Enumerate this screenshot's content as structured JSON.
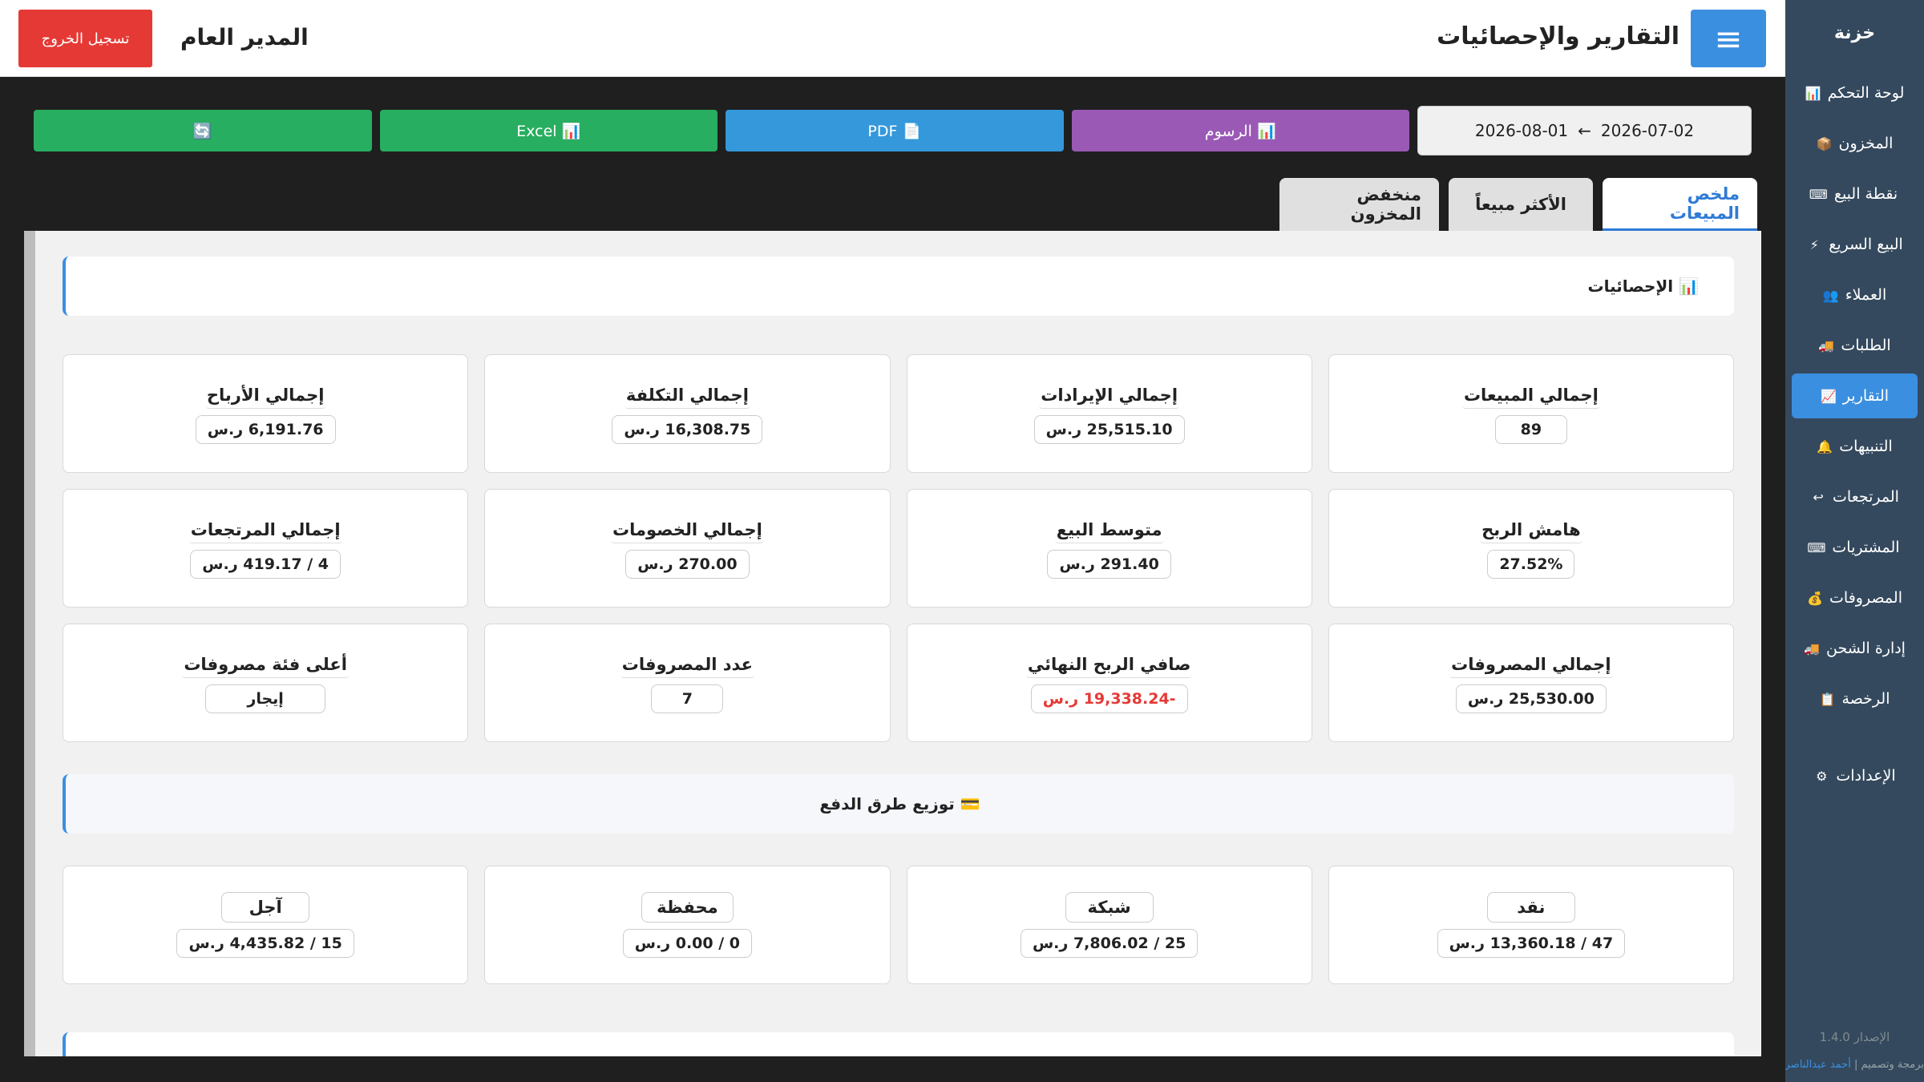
{
  "sidebar": {
    "brand": "خزنة",
    "items": [
      {
        "label": "لوحة التحكم",
        "icon": "📊"
      },
      {
        "label": "المخزون",
        "icon": "📦"
      },
      {
        "label": "نقطة البيع",
        "icon": "⌨"
      },
      {
        "label": "البيع السريع",
        "icon": "⚡"
      },
      {
        "label": "العملاء",
        "icon": "👥"
      },
      {
        "label": "الطلبات",
        "icon": "🚚"
      },
      {
        "label": "التقارير",
        "icon": "📈"
      },
      {
        "label": "التنبيهات",
        "icon": "🔔"
      },
      {
        "label": "المرتجعات",
        "icon": "↩"
      },
      {
        "label": "المشتريات",
        "icon": "⌨"
      },
      {
        "label": "المصروفات",
        "icon": "💰"
      },
      {
        "label": "إدارة الشحن",
        "icon": "🚚"
      },
      {
        "label": "الرخصة",
        "icon": "📋"
      },
      {
        "label": "الإعدادات",
        "icon": "⚙"
      }
    ],
    "active_index": 6,
    "version": "الإصدار 1.4.0",
    "credit_prefix": "برمجة وتصميم |",
    "credit_name": "أحمد عبدالناصر"
  },
  "header": {
    "title": "التقارير والإحصائيات",
    "menu_icon": "≡",
    "user": "المدير العام",
    "logout": "تسجيل الخروج"
  },
  "toolbar": {
    "date_from": "2026-07-02",
    "date_arrow": "←",
    "date_to": "2026-08-01",
    "charts": "📊 الرسوم",
    "pdf": "📄 PDF",
    "excel": "📊 Excel",
    "refresh": "🔄"
  },
  "tabs": [
    "ملخص المبيعات",
    "الأكثر مبيعاً",
    "منخفض المخزون"
  ],
  "stats": {
    "title": "📊 الإحصائيات",
    "cards": [
      {
        "label": "إجمالي المبيعات",
        "value": "89"
      },
      {
        "label": "إجمالي الإيرادات",
        "value": "25,515.10 ر.س"
      },
      {
        "label": "إجمالي التكلفة",
        "value": "16,308.75 ر.س"
      },
      {
        "label": "إجمالي الأرباح",
        "value": "6,191.76 ر.س"
      },
      {
        "label": "هامش الربح",
        "value": "27.52%"
      },
      {
        "label": "متوسط البيع",
        "value": "291.40 ر.س"
      },
      {
        "label": "إجمالي الخصومات",
        "value": "270.00 ر.س"
      },
      {
        "label": "إجمالي المرتجعات",
        "value": "4 / 419.17 ر.س"
      },
      {
        "label": "إجمالي المصروفات",
        "value": "25,530.00 ر.س"
      },
      {
        "label": "صافي الربح النهائي",
        "value": "-19,338.24 ر.س"
      },
      {
        "label": "عدد المصروفات",
        "value": "7"
      },
      {
        "label": "أعلى فئة مصروفات",
        "value": "إيجار"
      }
    ]
  },
  "payments": {
    "title": "💳 توزيع طرق الدفع",
    "items": [
      {
        "label": "نقد",
        "value": "47 / 13,360.18 ر.س"
      },
      {
        "label": "شبكة",
        "value": "25 / 7,806.02 ر.س"
      },
      {
        "label": "محفظة",
        "value": "0 / 0.00 ر.س"
      },
      {
        "label": "آجل",
        "value": "15 / 4,435.82 ر.س"
      }
    ]
  },
  "colors": {
    "accent": "#3b8fe0",
    "sidebar": "#34495e",
    "negative": "#e53935",
    "logout": "#e53935"
  }
}
